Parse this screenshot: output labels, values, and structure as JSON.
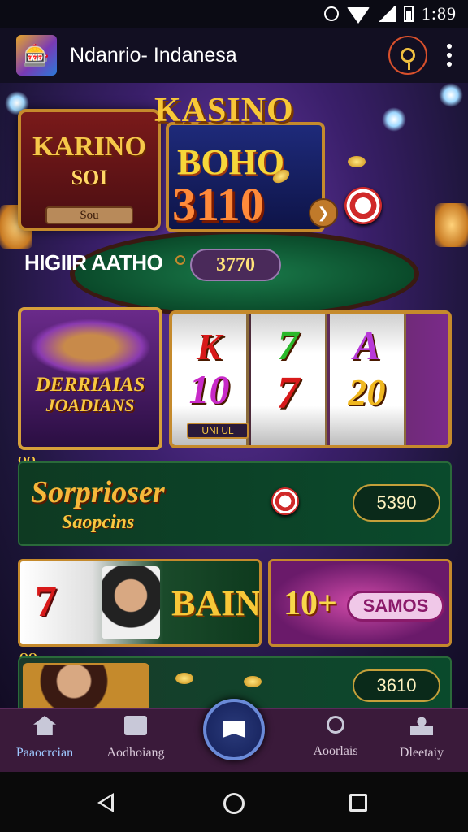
{
  "status_bar": {
    "time": "1:89"
  },
  "app_bar": {
    "title": "Ndanrio- Indanesa"
  },
  "hero": {
    "left_title": "KARINO",
    "left_value": "SOI",
    "left_button": "Sou",
    "brand": "KASINO",
    "right_value_top": "BOHO",
    "right_value_bottom": "3110",
    "arrow": "❯"
  },
  "headline": {
    "text": "HIGIIR AATHO",
    "pill_value": "3770"
  },
  "promo_card": {
    "line1": "DERRIAIAS",
    "line2": "JOADIANS"
  },
  "slot_machine": {
    "reels": [
      {
        "top": "K",
        "bottom": "10"
      },
      {
        "top": "7",
        "bottom": "7"
      },
      {
        "top": "A",
        "bottom": "20"
      }
    ],
    "tag": "UNI UL"
  },
  "banner": {
    "title": "Sorprioser",
    "subtitle": "Saopcins",
    "value": "5390"
  },
  "tile_slot": {
    "seven": "7",
    "word": "BAIN"
  },
  "tile_samos": {
    "number": "10+",
    "label": "SAMOS"
  },
  "row_bottom": {
    "value": "3610"
  },
  "corner_tags": {
    "banner": "QO",
    "row": "QO"
  },
  "bottom_nav": {
    "items": [
      {
        "label": "Paaocrcian",
        "icon": "home-icon"
      },
      {
        "label": "Aodhoiang",
        "icon": "grid-icon"
      },
      {
        "label": "Aoorlais",
        "icon": "search-icon"
      },
      {
        "label": "Dleetaiy",
        "icon": "user-icon"
      }
    ],
    "center_icon": "flag-icon"
  },
  "colors": {
    "accent": "#c58a2c",
    "nav_active": "#9ec8ff",
    "app_bar_bg": "#120f22"
  }
}
